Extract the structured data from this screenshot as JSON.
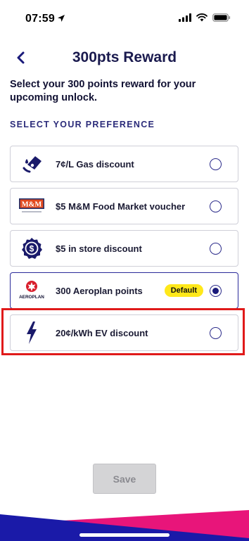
{
  "status_bar": {
    "time": "07:59"
  },
  "header": {
    "title": "300pts Reward"
  },
  "subtitle": "Select your 300 points reward for your upcoming unlock.",
  "section_label": "SELECT YOUR PREFERENCE",
  "options": [
    {
      "label": "7¢/L Gas discount",
      "icon": "gas-pump-icon",
      "selected": false
    },
    {
      "label": "$5 M&M Food Market voucher",
      "icon": "mm-food-market-logo",
      "logo_text": "M&M",
      "selected": false
    },
    {
      "label": "$5 in store discount",
      "icon": "dollar-badge-icon",
      "selected": false
    },
    {
      "label": "300 Aeroplan points",
      "icon": "aeroplan-logo",
      "logo_text": "AEROPLAN",
      "badge": "Default",
      "selected": true
    },
    {
      "label": "20¢/kWh EV discount",
      "icon": "lightning-bolt-icon",
      "selected": false
    }
  ],
  "save_label": "Save",
  "colors": {
    "brand_navy": "#1a1a7a",
    "badge_yellow": "#ffe81a",
    "footer_pink": "#e8157a",
    "highlight_red": "#e01a1a"
  }
}
